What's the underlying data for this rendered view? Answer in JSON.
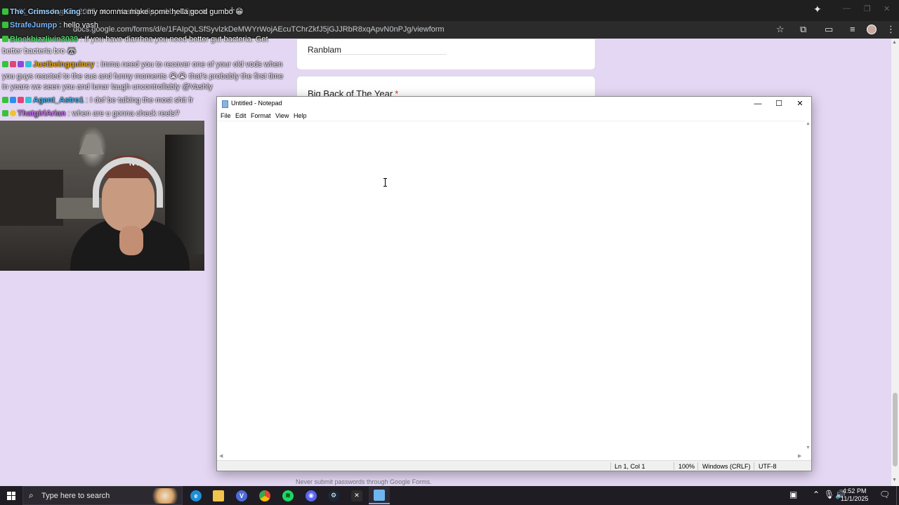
{
  "browser": {
    "tabs": [
      {
        "label": "YK Game Awards 2025"
      },
      {
        "label": "Vashly clipped by Clipo"
      }
    ],
    "url": "docs.google.com/forms/d/e/1FAIpQLSfSyvlzkDeMWYrWojAEcuTChrZkfJ5jGJJRbR8xqApvN0nPJg/viewform"
  },
  "form": {
    "previous_answer": "Ranblam",
    "question_title": "Biq Back of The Year",
    "required_marker": "*",
    "footer_note": "Never submit passwords through Google Forms.",
    "help_glyph": "?"
  },
  "chat": {
    "messages": [
      {
        "user": "The_Crimson_King",
        "user_color": "#9bd1ff",
        "text": " : my momma make some hella good gumbo 😁"
      },
      {
        "user": "StrafeJumpp",
        "user_color": "#7ab8ff",
        "text": " : hello vash"
      },
      {
        "user": "Blockbizzlivin3039",
        "user_color": "#4fd96b",
        "text": " : If you have diarrhea you need better gut bacteria. Get"
      },
      {
        "user": "",
        "user_color": "#ffffff",
        "text": "better bacteria bro 🦝"
      },
      {
        "user": "Justbeingquincy",
        "user_color": "#f0a800",
        "text": " : imma need you to recover one of your old vods when"
      },
      {
        "user": "",
        "user_color": "#ffffff",
        "text": "you guys reacted to the sus and funny moments 😭😭 that's probably the first time"
      },
      {
        "user": "",
        "user_color": "#ffffff",
        "text": "in years we seen you and lunar laugh uncontrollably @Vashly"
      },
      {
        "user": "Agent_Astro1",
        "user_color": "#3fb0e8",
        "text": " : I def be talking the most shit fr"
      },
      {
        "user": "ThatgirlArian",
        "user_color": "#c86bf0",
        "text": " : when are u gonna check reels?"
      }
    ]
  },
  "webcam": {
    "cap_logo": "NY"
  },
  "notepad": {
    "title": "Untitled - Notepad",
    "menu": [
      "File",
      "Edit",
      "Format",
      "View",
      "Help"
    ],
    "content": "",
    "status": {
      "position": "Ln 1, Col 1",
      "zoom": "100%",
      "line_ending": "Windows (CRLF)",
      "encoding": "UTF-8"
    }
  },
  "taskbar": {
    "search_placeholder": "Type here to search",
    "apps": [
      "edge",
      "file-explorer",
      "vpn",
      "chrome",
      "spotify",
      "discord",
      "steam",
      "xbox",
      "notepad"
    ],
    "clock_time": "4:52 PM",
    "clock_date": "11/1/2025"
  },
  "colors": {
    "page_background": "#e4d7f3",
    "accent_required": "#d93025",
    "taskbar": "#1f1c24"
  }
}
